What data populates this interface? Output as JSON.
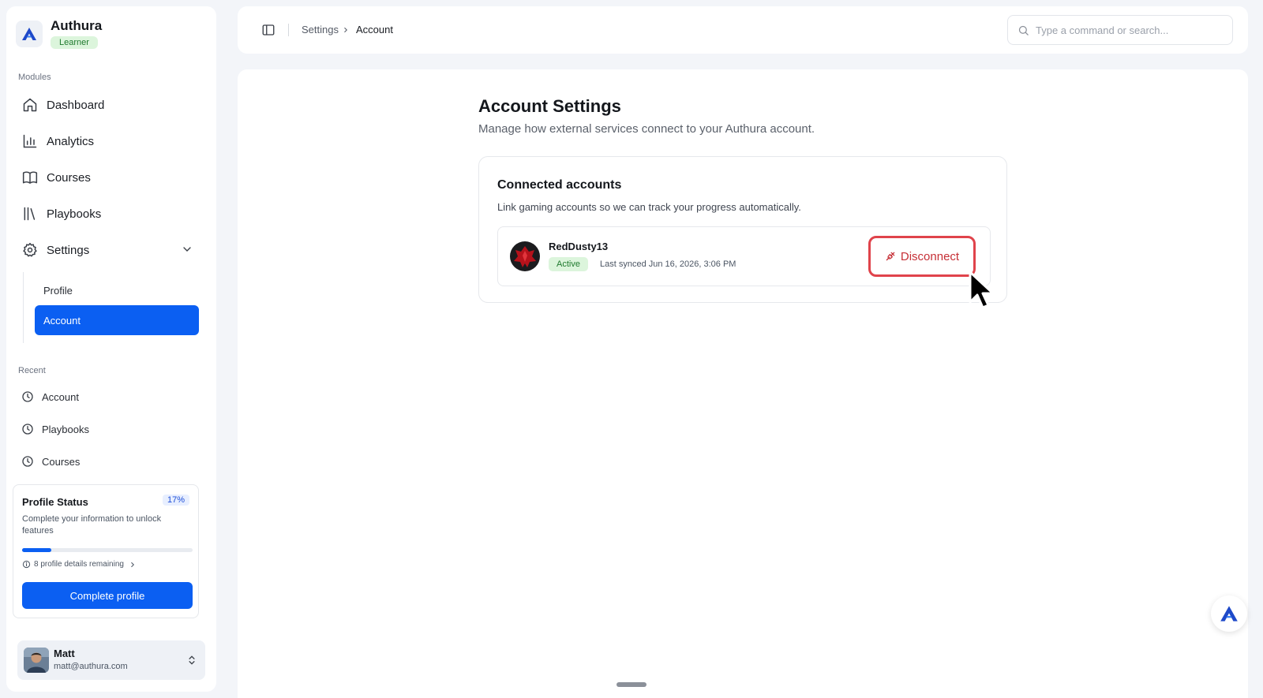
{
  "brand": {
    "name": "Authura",
    "badge": "Learner"
  },
  "sidebar": {
    "modules_label": "Modules",
    "items": [
      {
        "label": "Dashboard",
        "icon": "home-icon"
      },
      {
        "label": "Analytics",
        "icon": "bar-chart-icon"
      },
      {
        "label": "Courses",
        "icon": "book-icon"
      },
      {
        "label": "Playbooks",
        "icon": "library-icon"
      },
      {
        "label": "Settings",
        "icon": "gear-icon",
        "expanded": true
      }
    ],
    "settings_sub": [
      {
        "label": "Profile",
        "active": false
      },
      {
        "label": "Account",
        "active": true
      }
    ],
    "recent_label": "Recent",
    "recent": [
      {
        "label": "Account",
        "icon": "clock-icon"
      },
      {
        "label": "Playbooks",
        "icon": "clock-icon"
      },
      {
        "label": "Courses",
        "icon": "clock-icon"
      }
    ]
  },
  "profile_status": {
    "title": "Profile Status",
    "percent_label": "17%",
    "progress_fraction": 0.17,
    "description": "Complete your information to unlock features",
    "remaining": "8 profile details remaining",
    "button": "Complete profile"
  },
  "user": {
    "name": "Matt",
    "email": "matt@authura.com"
  },
  "topbar": {
    "breadcrumb": [
      "Settings",
      "Account"
    ],
    "search_placeholder": "Type a command or search..."
  },
  "page": {
    "title": "Account Settings",
    "subtitle": "Manage how external services connect to your Authura account."
  },
  "connected": {
    "title": "Connected accounts",
    "subtitle": "Link gaming accounts so we can track your progress automatically.",
    "account": {
      "name": "RedDusty13",
      "status": "Active",
      "last_synced": "Last synced Jun 16, 2026, 3:06 PM",
      "action": "Disconnect"
    }
  },
  "colors": {
    "accent": "#0b5ff2",
    "danger": "#e0434b",
    "success_bg": "#dcf5dc",
    "success_text": "#1f7a2e"
  }
}
